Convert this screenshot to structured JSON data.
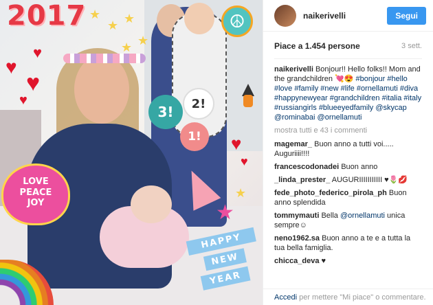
{
  "photo": {
    "sticker_year": "2017",
    "balloons": [
      "3!",
      "2!",
      "1!"
    ],
    "love_sticker": [
      "LOVE",
      "PEACE",
      "JOY"
    ],
    "banner": [
      "HAPPY",
      "NEW",
      "YEAR"
    ]
  },
  "header": {
    "username": "naikerivelli",
    "follow_label": "Segui"
  },
  "likes": {
    "text": "Piace a 1.454 persone",
    "time": "3 sett."
  },
  "caption": {
    "user": "naikerivelli",
    "text": "Bonjour!! Hello folks!! Mom and the grandchildren 💘😍",
    "tags": [
      "#bonjour",
      "#hello",
      "#love",
      "#family",
      "#new",
      "#life",
      "#ornellamuti",
      "#diva",
      "#happynewyear",
      "#grandchildren",
      "#italia",
      "#italy",
      "#russiangirls",
      "#blueeyedfamily",
      "@skycap",
      "@rominabai",
      "@ornellamuti"
    ]
  },
  "more_comments": "mostra tutti e 43 i commenti",
  "comments": [
    {
      "user": "magemar_",
      "text": "Buon anno a tutti voi..... Auguriiii!!!!"
    },
    {
      "user": "francescodonadei",
      "text": "Buon anno"
    },
    {
      "user": "_linda_prester_",
      "text": "AUGURIIIIIIIIIII ♥🌷💋"
    },
    {
      "user": "fede_photo_federico_pirola_ph",
      "text": "Buon anno splendida"
    },
    {
      "user": "tommymauti",
      "text": "Bella",
      "mention": "@ornellamuti",
      "tail": "unica sempre☺"
    },
    {
      "user": "neno1962.sa",
      "text": "Buon anno a te e a tutta la tua bella famiglia."
    },
    {
      "user": "chicca_deva",
      "text": "♥"
    }
  ],
  "footer": {
    "link": "Accedi",
    "text": "per mettere \"Mi piace\" o commentare."
  }
}
